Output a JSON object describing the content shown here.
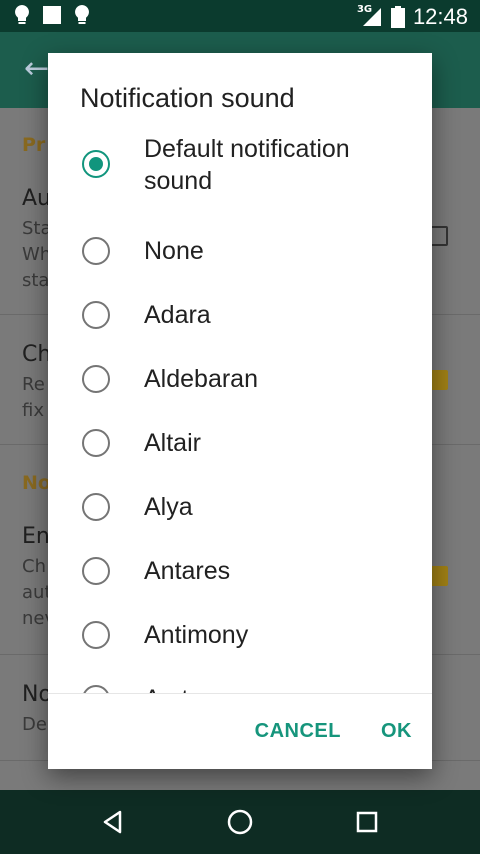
{
  "status_bar": {
    "time": "12:48",
    "network": "3G",
    "icons": [
      "lightbulb-icon",
      "square-icon",
      "lightbulb-icon",
      "signal-icon",
      "battery-icon"
    ]
  },
  "app_bar": {
    "back_icon": "arrow-back-icon"
  },
  "background": {
    "section1_label": "Pr",
    "item1_title": "Au",
    "item1_sub": [
      "Sta",
      "Wh",
      "sta"
    ],
    "item2_title": "Ch",
    "item2_sub": [
      "Re",
      "fix"
    ],
    "section2_label": "No",
    "item3_title": "En",
    "item3_sub": [
      "Ch",
      "aut",
      "nev"
    ],
    "item4_title": "No",
    "item4_sub": [
      "De"
    ]
  },
  "dialog": {
    "title": "Notification sound",
    "options": [
      {
        "label": "Default notification sound",
        "selected": true
      },
      {
        "label": "None",
        "selected": false
      },
      {
        "label": "Adara",
        "selected": false
      },
      {
        "label": "Aldebaran",
        "selected": false
      },
      {
        "label": "Altair",
        "selected": false
      },
      {
        "label": "Alya",
        "selected": false
      },
      {
        "label": "Antares",
        "selected": false
      },
      {
        "label": "Antimony",
        "selected": false
      },
      {
        "label": "Arcturus",
        "selected": false
      }
    ],
    "cancel_label": "CANCEL",
    "ok_label": "OK"
  },
  "nav_bar": {
    "icons": [
      "back-triangle-icon",
      "home-circle-icon",
      "recents-square-icon"
    ]
  },
  "colors": {
    "accent": "#11957d",
    "status_bar": "#0b3b2e",
    "app_bar": "#1c5d4d"
  }
}
